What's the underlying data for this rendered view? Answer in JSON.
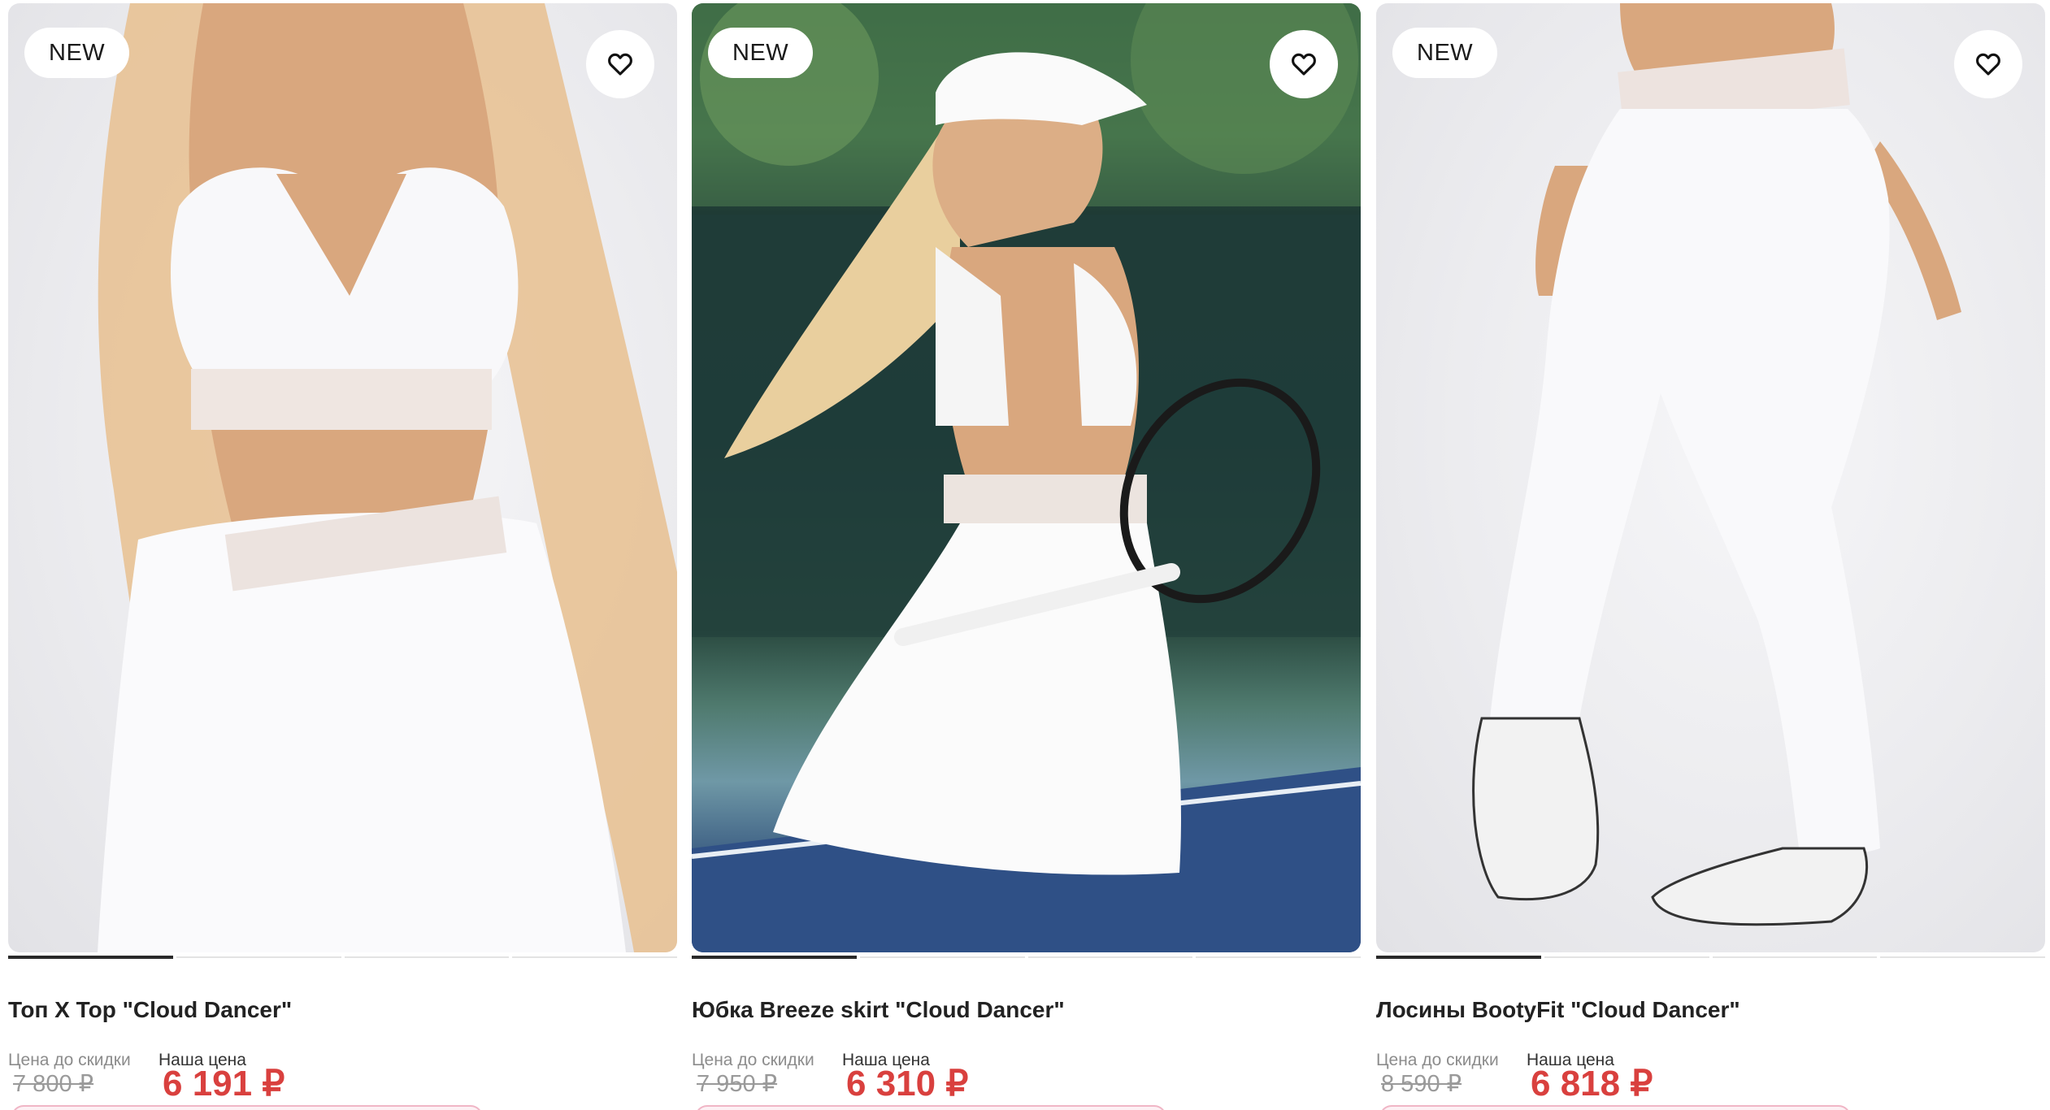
{
  "products": [
    {
      "badge": "NEW",
      "name": "Топ X Top \"Cloud Dancer\"",
      "old_price_label": "Цена до скидки",
      "old_price": "7 800 ₽",
      "new_price_label": "Наша цена",
      "new_price": "6 191 ₽",
      "slides": 4,
      "active_slide": 1,
      "favorite_icon": "heart-outline-icon"
    },
    {
      "badge": "NEW",
      "name": "Юбка Breeze skirt \"Cloud Dancer\"",
      "old_price_label": "Цена до скидки",
      "old_price": "7 950 ₽",
      "new_price_label": "Наша цена",
      "new_price": "6 310 ₽",
      "slides": 4,
      "active_slide": 1,
      "favorite_icon": "heart-outline-icon"
    },
    {
      "badge": "NEW",
      "name": "Лосины BootyFit \"Cloud Dancer\"",
      "old_price_label": "Цена до скидки",
      "old_price": "8 590 ₽",
      "new_price_label": "Наша цена",
      "new_price": "6 818 ₽",
      "slides": 4,
      "active_slide": 1,
      "favorite_icon": "heart-outline-icon"
    }
  ],
  "colors": {
    "sale_price": "#d9403e",
    "badge_bg": "#ffffff",
    "active_indicator": "#2a2a2a"
  }
}
